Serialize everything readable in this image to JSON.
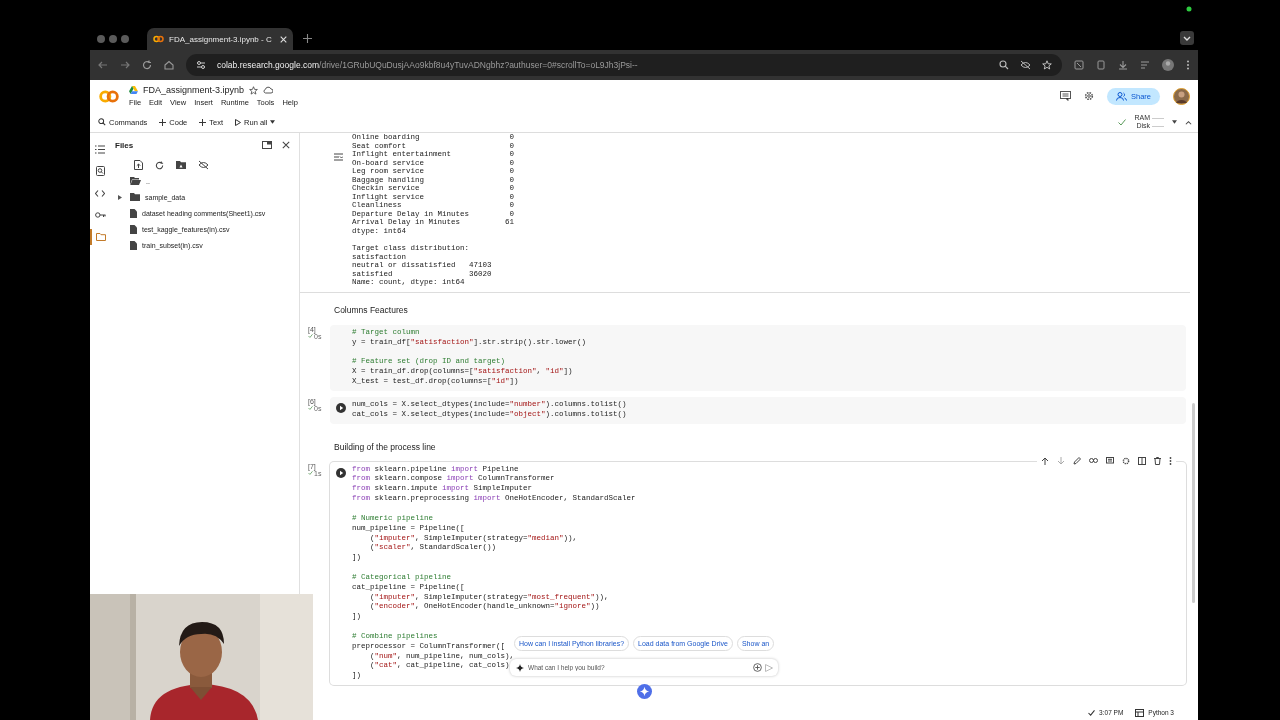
{
  "browser": {
    "tab_title": "FDA_assignment-3.ipynb - C",
    "url_host": "colab.research.google.com",
    "url_path": "/drive/1GRubUQuDusjAAo9kbf8u4yTuvADNgbhz?authuser=0#scrollTo=oL9Jh3jPsi--"
  },
  "notebook": {
    "title": "FDA_assignment-3.ipynb",
    "menu": [
      "File",
      "Edit",
      "View",
      "Insert",
      "Runtime",
      "Tools",
      "Help"
    ],
    "share": "Share"
  },
  "toolbar": {
    "buttons": [
      {
        "kind": "search",
        "label": "Commands"
      },
      {
        "kind": "add",
        "label": "Code"
      },
      {
        "kind": "add",
        "label": "Text"
      },
      {
        "kind": "run",
        "label": "Run all"
      }
    ],
    "ram": "RAM",
    "disk": "Disk"
  },
  "rail": [
    {
      "kind": "toc",
      "selected": false
    },
    {
      "kind": "search",
      "selected": false
    },
    {
      "kind": "code",
      "selected": false
    },
    {
      "kind": "key",
      "selected": false
    },
    {
      "kind": "folder",
      "selected": true
    }
  ],
  "files": {
    "title": "Files",
    "items": [
      {
        "kind": "up",
        "name": ".."
      },
      {
        "kind": "folder",
        "name": "sample_data"
      },
      {
        "kind": "file",
        "name": "dataset heading comments(Sheet1).csv"
      },
      {
        "kind": "file",
        "name": "test_kaggle_features(in).csv"
      },
      {
        "kind": "file",
        "name": "train_subset(in).csv"
      }
    ]
  },
  "cells": [
    {
      "kind": "output",
      "blocks": [
        [
          "Online boarding                    0",
          "Seat comfort                       0",
          "Inflight entertainment             0",
          "On-board service                   0",
          "Leg room service                   0",
          "Baggage handling                   0",
          "Checkin service                    0",
          "Inflight service                   0",
          "Cleanliness                        0",
          "Departure Delay in Minutes         0",
          "Arrival Delay in Minutes          61",
          "dtype: int64"
        ],
        [
          "Target class distribution:",
          "satisfaction",
          "neutral or dissatisfied   47103",
          "satisfied                 36020",
          "Name: count, dtype: int64"
        ]
      ]
    },
    {
      "kind": "text",
      "text": "Columns Feactures"
    },
    {
      "kind": "code",
      "count": "[4]",
      "status": "0s",
      "run_button": false,
      "focused": false,
      "blocks": [
        [
          [
            {
              "kind": "com",
              "text": "# Target column"
            }
          ],
          [
            {
              "kind": "txt",
              "text": "y = train_df["
            },
            {
              "kind": "str",
              "text": "\"satisfaction\""
            },
            {
              "kind": "txt",
              "text": "].str.strip().str.lower()"
            }
          ]
        ],
        [
          [
            {
              "kind": "com",
              "text": "# Feature set (drop ID and target)"
            }
          ],
          [
            {
              "kind": "txt",
              "text": "X = train_df.drop(columns=["
            },
            {
              "kind": "str",
              "text": "\"satisfaction\""
            },
            {
              "kind": "txt",
              "text": ", "
            },
            {
              "kind": "str",
              "text": "\"id\""
            },
            {
              "kind": "txt",
              "text": "])"
            }
          ],
          [
            {
              "kind": "txt",
              "text": "X_test = test_df.drop(columns=["
            },
            {
              "kind": "str",
              "text": "\"id\""
            },
            {
              "kind": "txt",
              "text": "])"
            }
          ]
        ]
      ]
    },
    {
      "kind": "code",
      "count": "[6]",
      "status": "0s",
      "run_button": true,
      "focused": false,
      "blocks": [
        [
          [
            {
              "kind": "txt",
              "text": "num_cols = X.select_dtypes(include="
            },
            {
              "kind": "str",
              "text": "\"number\""
            },
            {
              "kind": "txt",
              "text": ").columns.tolist()"
            }
          ],
          [
            {
              "kind": "txt",
              "text": "cat_cols = X.select_dtypes(include="
            },
            {
              "kind": "str",
              "text": "\"object\""
            },
            {
              "kind": "txt",
              "text": ").columns.tolist()"
            }
          ]
        ]
      ]
    },
    {
      "kind": "text",
      "text": "Building of the process line"
    },
    {
      "kind": "code",
      "count": "[7]",
      "status": "1s",
      "run_button": true,
      "focused": true,
      "blocks": [
        [
          [
            {
              "kind": "kw",
              "text": "from"
            },
            {
              "kind": "txt",
              "text": " sklearn.pipeline "
            },
            {
              "kind": "kw",
              "text": "import"
            },
            {
              "kind": "txt",
              "text": " Pipeline"
            }
          ],
          [
            {
              "kind": "kw",
              "text": "from"
            },
            {
              "kind": "txt",
              "text": " sklearn.compose "
            },
            {
              "kind": "kw",
              "text": "import"
            },
            {
              "kind": "txt",
              "text": " ColumnTransformer"
            }
          ],
          [
            {
              "kind": "kw",
              "text": "from"
            },
            {
              "kind": "txt",
              "text": " sklearn.impute "
            },
            {
              "kind": "kw",
              "text": "import"
            },
            {
              "kind": "txt",
              "text": " SimpleImputer"
            }
          ],
          [
            {
              "kind": "kw",
              "text": "from"
            },
            {
              "kind": "txt",
              "text": " sklearn.preprocessing "
            },
            {
              "kind": "kw",
              "text": "import"
            },
            {
              "kind": "txt",
              "text": " OneHotEncoder, StandardScaler"
            }
          ]
        ],
        [
          [
            {
              "kind": "com",
              "text": "# Numeric pipeline"
            }
          ],
          [
            {
              "kind": "txt",
              "text": "num_pipeline = Pipeline(["
            }
          ],
          [
            {
              "kind": "txt",
              "text": "    ("
            },
            {
              "kind": "str",
              "text": "\"imputer\""
            },
            {
              "kind": "txt",
              "text": ", SimpleImputer(strategy="
            },
            {
              "kind": "str",
              "text": "\"median\""
            },
            {
              "kind": "txt",
              "text": ")),"
            }
          ],
          [
            {
              "kind": "txt",
              "text": "    ("
            },
            {
              "kind": "str",
              "text": "\"scaler\""
            },
            {
              "kind": "txt",
              "text": ", StandardScaler())"
            }
          ],
          [
            {
              "kind": "txt",
              "text": "])"
            }
          ]
        ],
        [
          [
            {
              "kind": "com",
              "text": "# Categorical pipeline"
            }
          ],
          [
            {
              "kind": "txt",
              "text": "cat_pipeline = Pipeline(["
            }
          ],
          [
            {
              "kind": "txt",
              "text": "    ("
            },
            {
              "kind": "str",
              "text": "\"imputer\""
            },
            {
              "kind": "txt",
              "text": ", SimpleImputer(strategy="
            },
            {
              "kind": "str",
              "text": "\"most_frequent\""
            },
            {
              "kind": "txt",
              "text": ")),"
            }
          ],
          [
            {
              "kind": "txt",
              "text": "    ("
            },
            {
              "kind": "str",
              "text": "\"encoder\""
            },
            {
              "kind": "txt",
              "text": ", OneHotEncoder(handle_unknown="
            },
            {
              "kind": "str",
              "text": "\"ignore\""
            },
            {
              "kind": "txt",
              "text": "))"
            }
          ],
          [
            {
              "kind": "txt",
              "text": "])"
            }
          ]
        ],
        [
          [
            {
              "kind": "com",
              "text": "# Combine pipelines"
            }
          ],
          [
            {
              "kind": "txt",
              "text": "preprocessor = ColumnTransformer(["
            }
          ],
          [
            {
              "kind": "txt",
              "text": "    ("
            },
            {
              "kind": "str",
              "text": "\"num\""
            },
            {
              "kind": "txt",
              "text": ", num_pipeline, num_cols),"
            }
          ],
          [
            {
              "kind": "txt",
              "text": "    ("
            },
            {
              "kind": "str",
              "text": "\"cat\""
            },
            {
              "kind": "txt",
              "text": ", cat_pipeline, cat_cols)"
            }
          ],
          [
            {
              "kind": "txt",
              "text": "])"
            }
          ]
        ]
      ]
    }
  ],
  "suggestions": [
    "How can I install Python libraries?",
    "Load data from Google Drive",
    "Show an"
  ],
  "chat": {
    "placeholder": "What can I help you build?"
  },
  "status_bar": {
    "time": "3:07 PM",
    "runtime": "Python 3"
  }
}
